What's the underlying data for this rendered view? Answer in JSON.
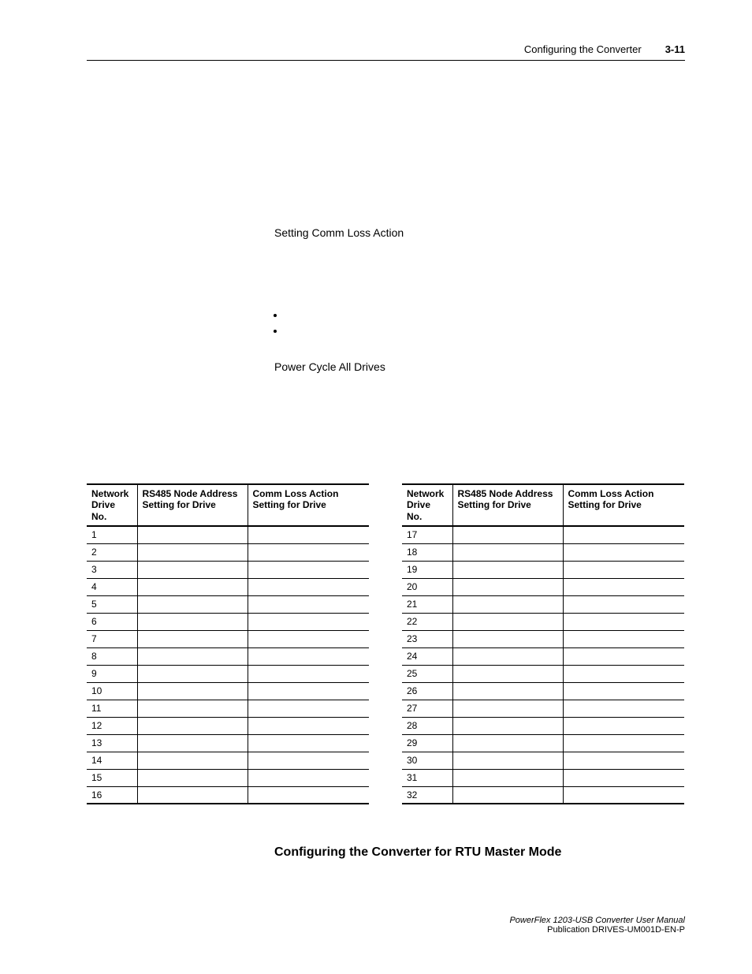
{
  "header": {
    "title": "Configuring the Converter",
    "page_number": "3-11"
  },
  "step_a": {
    "heading": "Setting Comm Loss Action"
  },
  "bullets": {
    "items": [
      "",
      ""
    ]
  },
  "step_b": {
    "heading": "Power Cycle All Drives"
  },
  "table_headers": {
    "col1": "Network Drive No.",
    "col2": "RS485 Node Address Setting for Drive",
    "col3": "Comm Loss Action Setting for Drive"
  },
  "chart_data": {
    "type": "table",
    "title": "Network drive configuration record",
    "columns": [
      "Network Drive No.",
      "RS485 Node Address Setting for Drive",
      "Comm Loss Action Setting for Drive"
    ],
    "left_rows": [
      [
        "1",
        "",
        ""
      ],
      [
        "2",
        "",
        ""
      ],
      [
        "3",
        "",
        ""
      ],
      [
        "4",
        "",
        ""
      ],
      [
        "5",
        "",
        ""
      ],
      [
        "6",
        "",
        ""
      ],
      [
        "7",
        "",
        ""
      ],
      [
        "8",
        "",
        ""
      ],
      [
        "9",
        "",
        ""
      ],
      [
        "10",
        "",
        ""
      ],
      [
        "11",
        "",
        ""
      ],
      [
        "12",
        "",
        ""
      ],
      [
        "13",
        "",
        ""
      ],
      [
        "14",
        "",
        ""
      ],
      [
        "15",
        "",
        ""
      ],
      [
        "16",
        "",
        ""
      ]
    ],
    "right_rows": [
      [
        "17",
        "",
        ""
      ],
      [
        "18",
        "",
        ""
      ],
      [
        "19",
        "",
        ""
      ],
      [
        "20",
        "",
        ""
      ],
      [
        "21",
        "",
        ""
      ],
      [
        "22",
        "",
        ""
      ],
      [
        "23",
        "",
        ""
      ],
      [
        "24",
        "",
        ""
      ],
      [
        "25",
        "",
        ""
      ],
      [
        "26",
        "",
        ""
      ],
      [
        "27",
        "",
        ""
      ],
      [
        "28",
        "",
        ""
      ],
      [
        "29",
        "",
        ""
      ],
      [
        "30",
        "",
        ""
      ],
      [
        "31",
        "",
        ""
      ],
      [
        "32",
        "",
        ""
      ]
    ]
  },
  "section_heading": "Configuring the Converter for RTU Master Mode",
  "footer": {
    "line1": "PowerFlex 1203-USB Converter User Manual",
    "line2": "Publication DRIVES-UM001D-EN-P"
  }
}
